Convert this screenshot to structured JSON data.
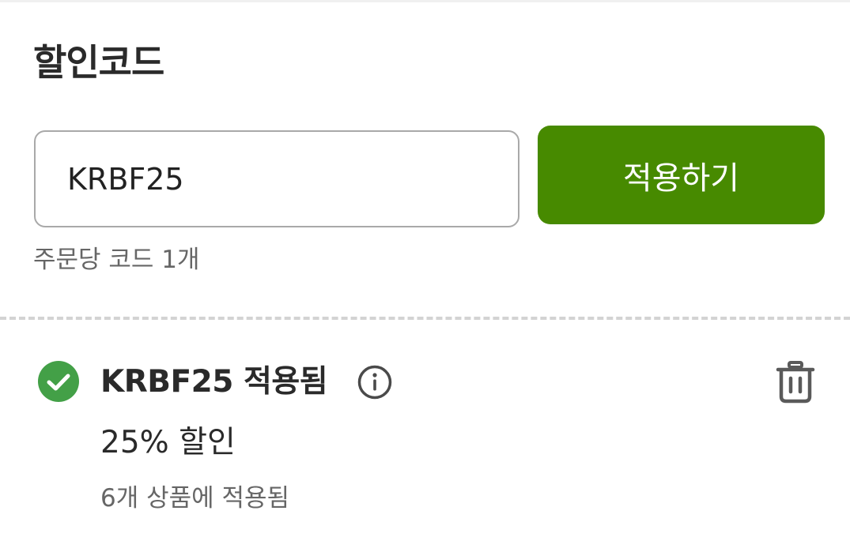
{
  "discount": {
    "title": "할인코드",
    "input": {
      "value": "KRBF25",
      "placeholder": ""
    },
    "apply_button_label": "적용하기",
    "helper_text": "주문당 코드 1개"
  },
  "applied_code": {
    "status_icon": "check-circle-icon",
    "title": "KRBF25 적용됨",
    "info_icon": "info-circle-icon",
    "remove_icon": "trash-icon",
    "discount_label": "25% 할인",
    "scope_label": "6개 상품에 적용됨"
  },
  "colors": {
    "primary_button": "#478a00",
    "success": "#43a047",
    "divider": "#d3d3d3",
    "input_border": "#a9a9a9",
    "muted_text": "#666666"
  }
}
